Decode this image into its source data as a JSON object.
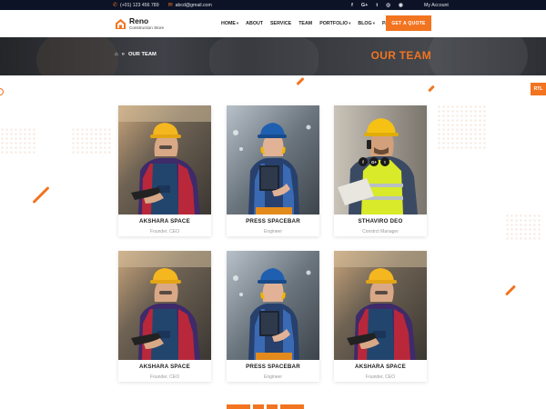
{
  "topbar": {
    "phone": "(+01) 123 456 789",
    "email": "abcd@gmail.com",
    "social": [
      {
        "label": "f",
        "icon": "facebook-icon"
      },
      {
        "label": "G+",
        "icon": "google-plus-icon"
      },
      {
        "label": "t",
        "icon": "twitter-icon"
      },
      {
        "label": "◎",
        "icon": "instagram-icon"
      },
      {
        "label": "◉",
        "icon": "rss-icon"
      }
    ],
    "account": "My Account"
  },
  "brand": {
    "name": "Reno",
    "tagline": "Construction Store",
    "accent": "#f27420"
  },
  "nav": [
    {
      "label": "HOME",
      "dropdown": true
    },
    {
      "label": "ABOUT",
      "dropdown": false
    },
    {
      "label": "SERVICE",
      "dropdown": false
    },
    {
      "label": "TEAM",
      "dropdown": false
    },
    {
      "label": "PORTFOLIO",
      "dropdown": true
    },
    {
      "label": "BLOG",
      "dropdown": true
    },
    {
      "label": "PAGE",
      "dropdown": true
    }
  ],
  "quote_button": "GET A QUOTE",
  "breadcrumb": {
    "separator": "»",
    "current": "OUR TEAM"
  },
  "banner_title": "OUR TEAM",
  "rtl_label": "RTL",
  "team": [
    {
      "name": "AKSHARA SPACE",
      "role": "Founder, CEO",
      "photo": "female-worker-tablet"
    },
    {
      "name": "PRESS SPACEBAR",
      "role": "Engineer",
      "photo": "female-worker-clipboard"
    },
    {
      "name": "STHAVIRO DEO",
      "role": "Constrct Manager",
      "photo": "male-worker-phone",
      "social_hover": [
        "f",
        "G+",
        "t"
      ]
    },
    {
      "name": "AKSHARA SPACE",
      "role": "Founder, CEO",
      "photo": "female-worker-tablet"
    },
    {
      "name": "PRESS SPACEBAR",
      "role": "Engineer",
      "photo": "female-worker-clipboard"
    },
    {
      "name": "AKSHARA SPACE",
      "role": "Founder, CEO",
      "photo": "female-worker-tablet"
    }
  ]
}
